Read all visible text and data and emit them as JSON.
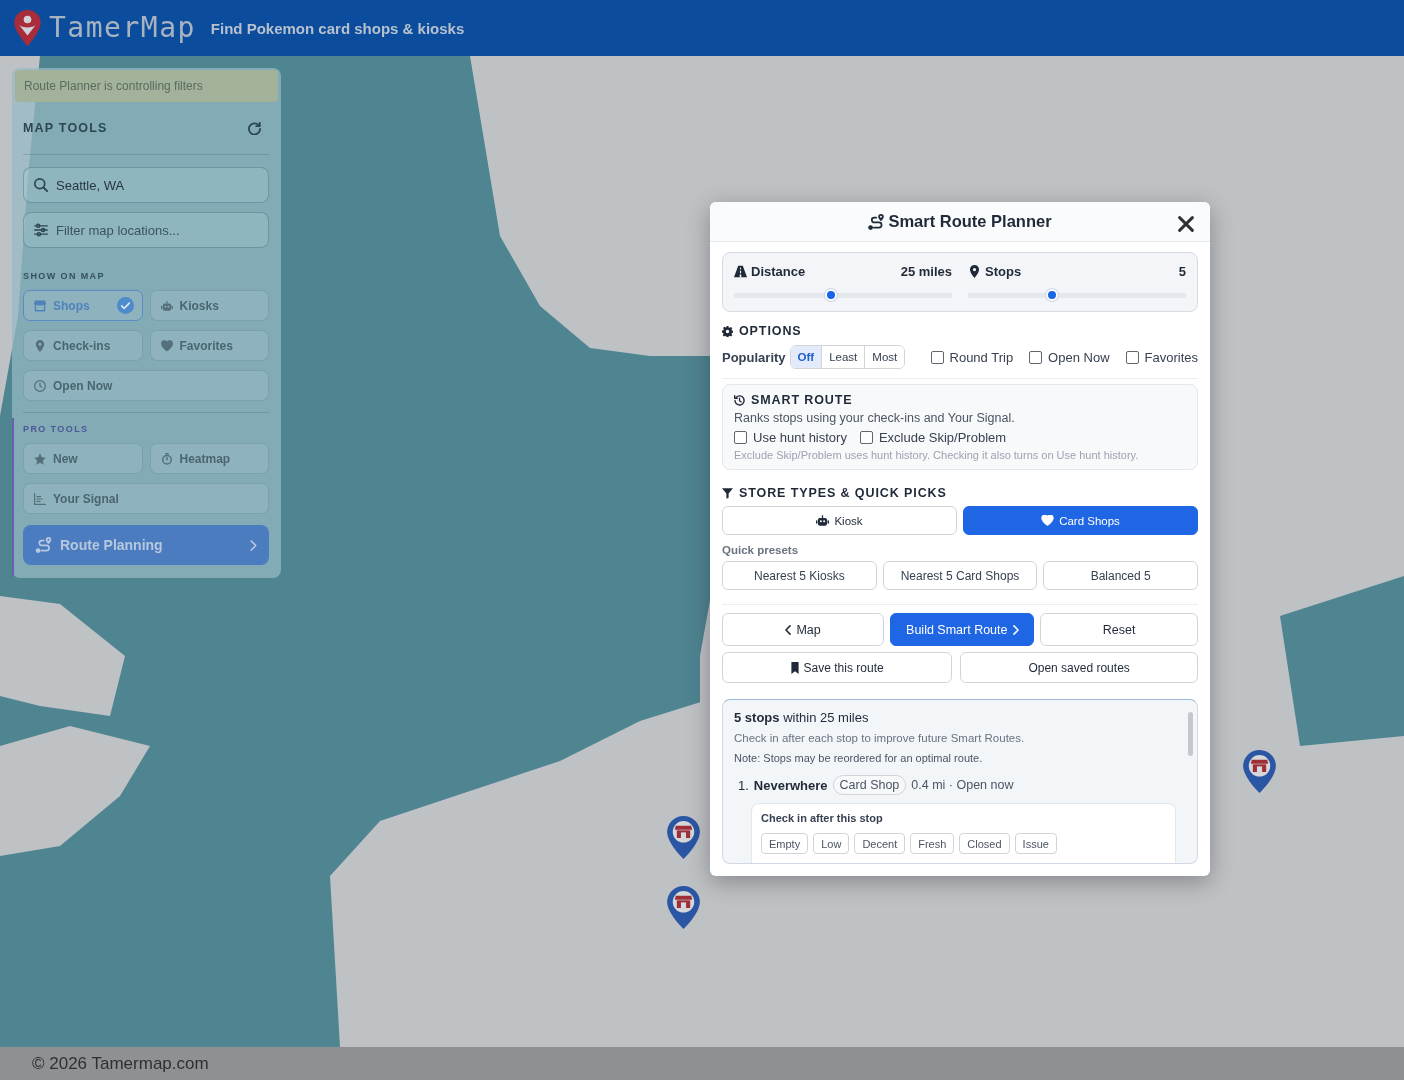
{
  "header": {
    "brand": "TamerMap",
    "tagline": "Find Pokemon card shops & kiosks"
  },
  "map_tools": {
    "banner": "Route Planner is controlling filters",
    "title": "MAP TOOLS",
    "search": {
      "value": "Seattle, WA"
    },
    "filter": {
      "placeholder": "Filter map locations..."
    },
    "show_on_map": {
      "label": "SHOW ON MAP",
      "toggles": [
        {
          "label": "Shops",
          "selected": true
        },
        {
          "label": "Kiosks",
          "selected": false
        },
        {
          "label": "Check-ins",
          "selected": false
        },
        {
          "label": "Favorites",
          "selected": false
        },
        {
          "label": "Open Now",
          "selected": false
        }
      ]
    },
    "pro_tools": {
      "label": "PRO TOOLS",
      "items": [
        "New",
        "Heatmap",
        "Your Signal"
      ]
    },
    "route_button": "Route Planning"
  },
  "route_planner": {
    "title": "Smart Route Planner",
    "sliders": [
      {
        "label": "Distance",
        "reading": "25 miles",
        "level": 0.44
      },
      {
        "label": "Stops",
        "reading": "5",
        "level": 0.38
      }
    ],
    "options": {
      "heading": "OPTIONS",
      "popularity": {
        "label": "Popularity",
        "segments": [
          {
            "label": "Off",
            "selected": true
          },
          {
            "label": "Least",
            "selected": false
          },
          {
            "label": "Most",
            "selected": false
          }
        ]
      },
      "checkboxes": [
        {
          "label": "Round Trip",
          "checked": false
        },
        {
          "label": "Open Now",
          "checked": false
        },
        {
          "label": "Favorites",
          "checked": false
        }
      ]
    },
    "smart_route": {
      "heading": "SMART ROUTE",
      "description": "Ranks stops using your check-ins and Your Signal.",
      "checkboxes": [
        {
          "label": "Use hunt history",
          "checked": false
        },
        {
          "label": "Exclude Skip/Problem",
          "checked": false
        }
      ],
      "note": "Exclude Skip/Problem uses hunt history. Checking it also turns on Use hunt history."
    },
    "store_types": {
      "heading": "STORE TYPES & QUICK PICKS",
      "types": [
        {
          "label": "Kiosk",
          "selected": false
        },
        {
          "label": "Card Shops",
          "selected": true
        }
      ],
      "presets_label": "Quick presets",
      "presets": [
        "Nearest 5 Kiosks",
        "Nearest 5 Card Shops",
        "Balanced 5"
      ]
    },
    "actions": [
      {
        "label": "Map",
        "kind": "back"
      },
      {
        "label": "Build Smart Route",
        "kind": "primary"
      },
      {
        "label": "Reset",
        "kind": "plain"
      }
    ],
    "save_actions": [
      {
        "label": "Save this route",
        "kind": "bookmark"
      },
      {
        "label": "Open saved routes",
        "kind": "plain"
      }
    ],
    "results": {
      "summary": "**5 stops** within 25 miles",
      "hint": "Check in after each stop to improve future Smart Routes.",
      "note": "Note: Stops may be reordered for an optimal route.",
      "stops": [
        {
          "number": "1.",
          "name": "Neverwhere",
          "type": "Card Shop",
          "details": "0.4 mi · Open now",
          "checkin": {
            "label": "Check in after this stop",
            "options": [
              "Empty",
              "Low",
              "Decent",
              "Fresh",
              "Closed",
              "Issue"
            ]
          }
        }
      ]
    }
  },
  "footer": {
    "copyright": "© 2026 Tamermap.com"
  }
}
